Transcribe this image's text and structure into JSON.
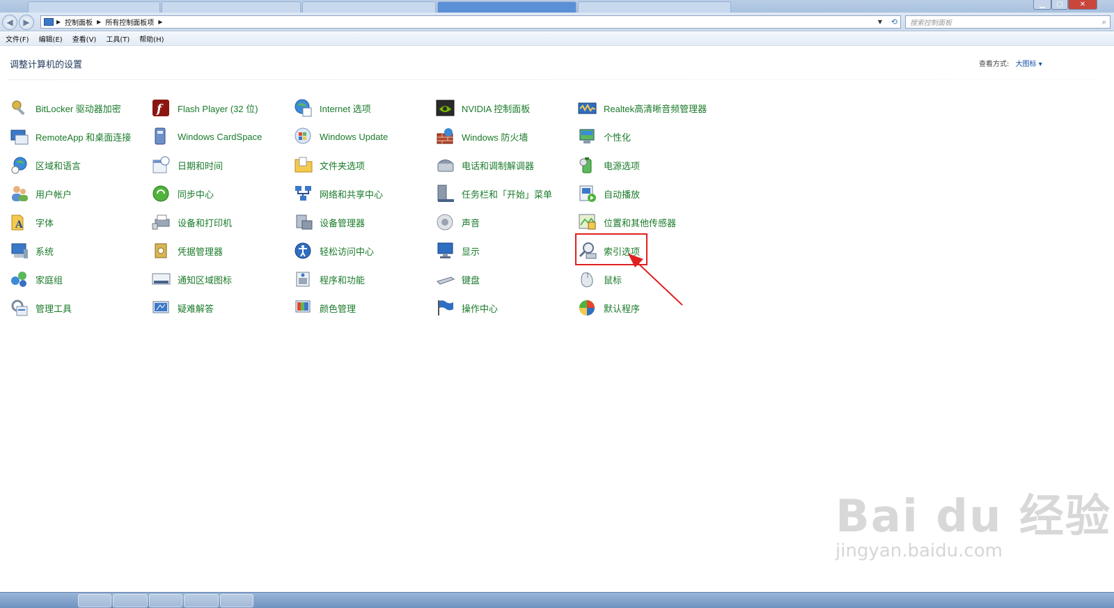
{
  "address": {
    "crumbs": [
      "控制面板",
      "所有控制面板项"
    ],
    "search_placeholder": "搜索控制面板"
  },
  "menu": [
    "文件(F)",
    "编辑(E)",
    "查看(V)",
    "工具(T)",
    "帮助(H)"
  ],
  "header": {
    "title": "调整计算机的设置",
    "view_by_label": "查看方式:",
    "view_by_value": "大图标 ▾"
  },
  "columns": [
    [
      "BitLocker 驱动器加密",
      "RemoteApp 和桌面连接",
      "区域和语言",
      "用户帐户",
      "字体",
      "系统",
      "家庭组",
      "管理工具"
    ],
    [
      "Flash Player (32 位)",
      "Windows CardSpace",
      "日期和时间",
      "同步中心",
      "设备和打印机",
      "凭据管理器",
      "通知区域图标",
      "疑难解答"
    ],
    [
      "Internet 选项",
      "Windows Update",
      "文件夹选项",
      "网络和共享中心",
      "设备管理器",
      "轻松访问中心",
      "程序和功能",
      "颜色管理"
    ],
    [
      "NVIDIA 控制面板",
      "Windows 防火墙",
      "电话和调制解调器",
      "任务栏和「开始」菜单",
      "声音",
      "显示",
      "键盘",
      "操作中心"
    ],
    [
      "Realtek高清晰音频管理器",
      "个性化",
      "电源选项",
      "自动播放",
      "位置和其他传感器",
      "索引选项",
      "鼠标",
      "默认程序"
    ]
  ],
  "highlight_color": "#e02020",
  "link_color": "#1a7a2a",
  "watermark": {
    "brand": "Bai  du 经验",
    "url": "jingyan.baidu.com"
  }
}
